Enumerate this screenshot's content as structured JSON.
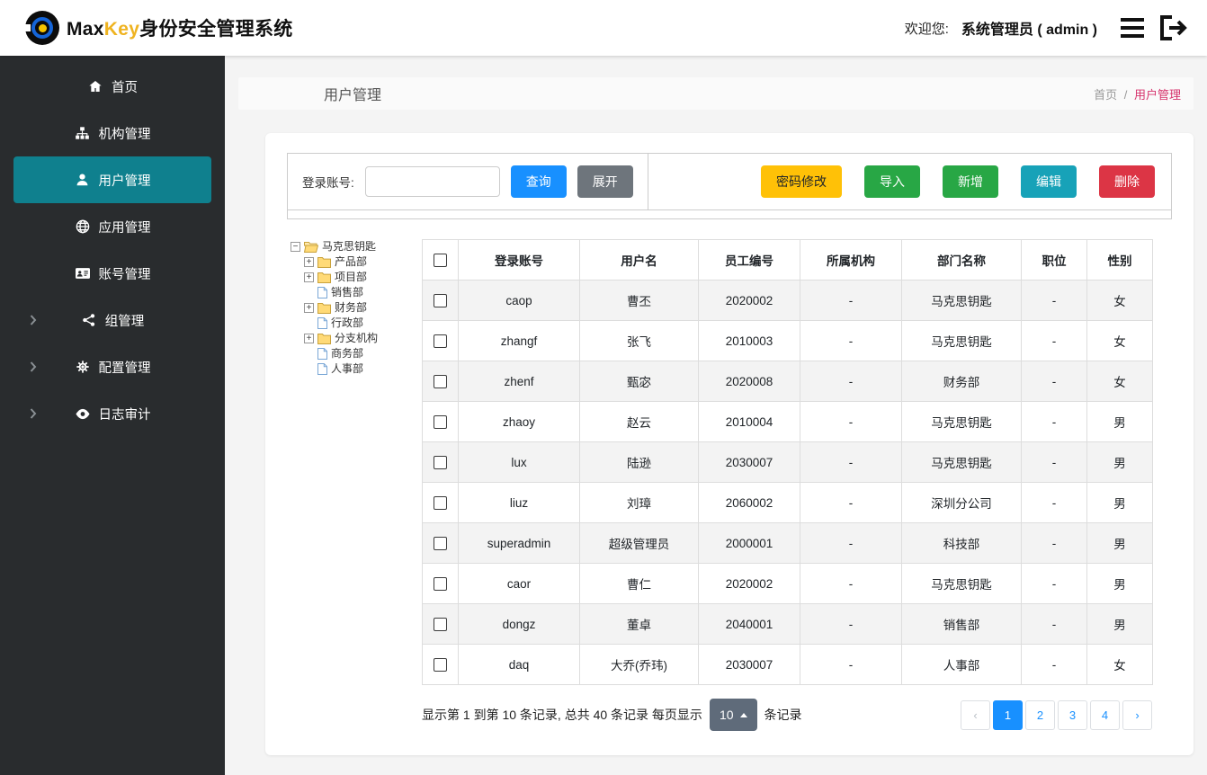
{
  "header": {
    "brand_max": "Max",
    "brand_key": "Key",
    "brand_suffix": "身份安全管理系统",
    "welcome": "欢迎您:",
    "user": "系统管理员 ( admin )"
  },
  "sidebar": {
    "items": [
      {
        "label": "首页",
        "icon": "home",
        "active": false,
        "chevron": false
      },
      {
        "label": "机构管理",
        "icon": "sitemap",
        "active": false,
        "chevron": false
      },
      {
        "label": "用户管理",
        "icon": "user",
        "active": true,
        "chevron": false
      },
      {
        "label": "应用管理",
        "icon": "globe",
        "active": false,
        "chevron": false
      },
      {
        "label": "账号管理",
        "icon": "idcard",
        "active": false,
        "chevron": false
      },
      {
        "label": "组管理",
        "icon": "group",
        "active": false,
        "chevron": true
      },
      {
        "label": "配置管理",
        "icon": "gears",
        "active": false,
        "chevron": true
      },
      {
        "label": "日志审计",
        "icon": "eye",
        "active": false,
        "chevron": true
      }
    ]
  },
  "page": {
    "title": "用户管理",
    "breadcrumb_home": "首页",
    "breadcrumb_sep": "/",
    "breadcrumb_current": "用户管理"
  },
  "filter": {
    "label": "登录账号:",
    "input_value": "",
    "search_label": "查询",
    "expand_label": "展开",
    "password_label": "密码修改",
    "import_label": "导入",
    "add_label": "新增",
    "edit_label": "编辑",
    "delete_label": "删除"
  },
  "tree": {
    "root_node": {
      "label": "马克思钥匙",
      "type": "folder-open",
      "toggle": "minus"
    },
    "nodes": [
      {
        "label": "产品部",
        "type": "folder",
        "toggle": "plus"
      },
      {
        "label": "项目部",
        "type": "folder",
        "toggle": "plus"
      },
      {
        "label": "销售部",
        "type": "file",
        "toggle": null
      },
      {
        "label": "财务部",
        "type": "folder",
        "toggle": "plus"
      },
      {
        "label": "行政部",
        "type": "file",
        "toggle": null
      },
      {
        "label": "分支机构",
        "type": "folder",
        "toggle": "plus"
      },
      {
        "label": "商务部",
        "type": "file",
        "toggle": null
      },
      {
        "label": "人事部",
        "type": "file",
        "toggle": null
      }
    ]
  },
  "table": {
    "headers": [
      "登录账号",
      "用户名",
      "员工编号",
      "所属机构",
      "部门名称",
      "职位",
      "性别"
    ],
    "rows": [
      [
        "caop",
        "曹丕",
        "2020002",
        "-",
        "马克思钥匙",
        "-",
        "女"
      ],
      [
        "zhangf",
        "张飞",
        "2010003",
        "-",
        "马克思钥匙",
        "-",
        "女"
      ],
      [
        "zhenf",
        "甄宓",
        "2020008",
        "-",
        "财务部",
        "-",
        "女"
      ],
      [
        "zhaoy",
        "赵云",
        "2010004",
        "-",
        "马克思钥匙",
        "-",
        "男"
      ],
      [
        "lux",
        "陆逊",
        "2030007",
        "-",
        "马克思钥匙",
        "-",
        "男"
      ],
      [
        "liuz",
        "刘璋",
        "2060002",
        "-",
        "深圳分公司",
        "-",
        "男"
      ],
      [
        "superadmin",
        "超级管理员",
        "2000001",
        "-",
        "科技部",
        "-",
        "男"
      ],
      [
        "caor",
        "曹仁",
        "2020002",
        "-",
        "马克思钥匙",
        "-",
        "男"
      ],
      [
        "dongz",
        "董卓",
        "2040001",
        "-",
        "销售部",
        "-",
        "男"
      ],
      [
        "daq",
        "大乔(乔玮)",
        "2030007",
        "-",
        "人事部",
        "-",
        "女"
      ]
    ]
  },
  "pagination": {
    "summary_prefix": "显示第 1 到第 10 条记录, 总共 40 条记录 每页显示",
    "page_size": "10",
    "summary_suffix": "条记录",
    "prev": "‹",
    "next": "›",
    "pages": [
      "1",
      "2",
      "3",
      "4"
    ],
    "active_page": "1"
  },
  "colors": {
    "primary": "#1890ff",
    "success": "#28a745",
    "warning": "#ffc107",
    "danger": "#dc3545",
    "info": "#17a2b8",
    "secondary": "#6e757c",
    "sidebar_bg": "#292c2e",
    "sidebar_active": "#0f808e",
    "brand_key": "#efb320",
    "breadcrumb_active": "#d6336c",
    "page_size_bg": "#5f6b7a"
  }
}
